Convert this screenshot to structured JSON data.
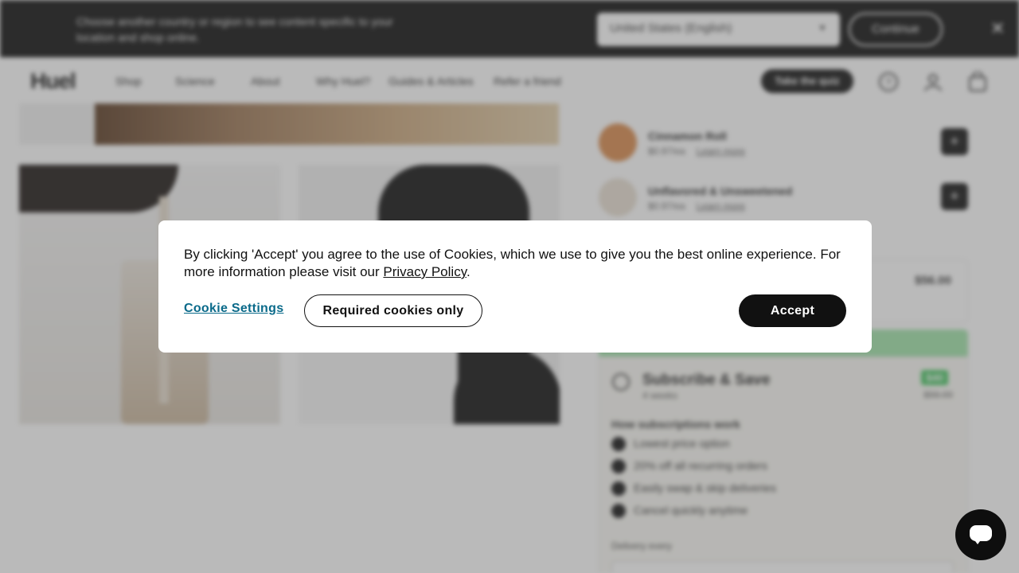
{
  "region_bar": {
    "message": "Choose another country or region to see content specific to your location and shop online.",
    "selected_region": "United States (English)",
    "continue_label": "Continue",
    "close_glyph": "✕"
  },
  "nav": {
    "logo": "Huel",
    "links": [
      "Shop",
      "Science",
      "About",
      "Why Huel?",
      "Guides & Articles",
      "Refer a friend"
    ],
    "quiz_label": "Take the quiz",
    "icons": [
      "help-icon",
      "account-icon",
      "cart-icon"
    ]
  },
  "product": {
    "flavours": [
      {
        "name": "Cinnamon Roll",
        "meta": "$0.97/ea",
        "link": "Learn more",
        "color": "#d9894a"
      },
      {
        "name": "Unflavored & Unsweetened",
        "meta": "$0.97/ea",
        "link": "Learn more",
        "color": "#e8dfd2"
      }
    ],
    "one_time_price": "$56.00",
    "subscribe": {
      "title": "Subscribe & Save",
      "frequency": "4 weeks",
      "badge": "$40",
      "old_price": "$56.00",
      "how_title": "How subscriptions work",
      "benefits": [
        "Lowest price option",
        "20% off all recurring orders",
        "Easily swap & skip deliveries",
        "Cancel quickly anytime"
      ],
      "delivery_label": "Delivery every"
    }
  },
  "cookie": {
    "text": "By clicking 'Accept' you agree to the use of Cookies, which we use to give you the best online experience. For more information please visit our ",
    "policy_link": "Privacy Policy",
    "trailing": ".",
    "settings_label": "Cookie Settings",
    "required_label": "Required cookies only",
    "accept_label": "Accept"
  },
  "chat": {
    "icon": "chat-bubble-icon"
  },
  "colors": {
    "accent": "#0a6a8a",
    "dark": "#111111",
    "subscribe_green": "#42c45e"
  }
}
